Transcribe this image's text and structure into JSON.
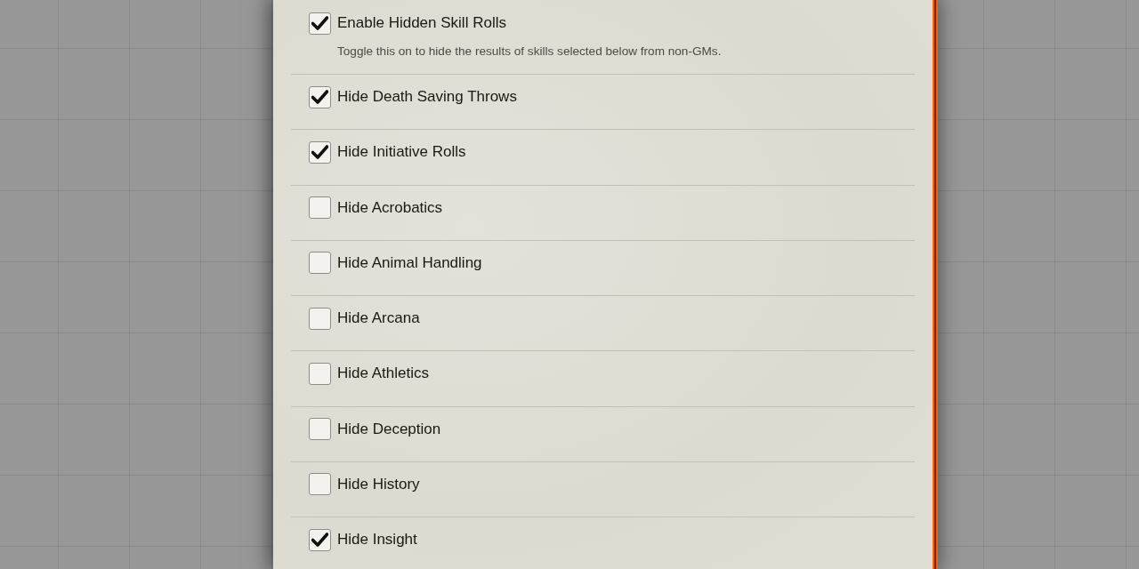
{
  "settings": [
    {
      "label": "Enable Hidden Skill Rolls",
      "hint": "Toggle this on to hide the results of skills selected below from non-GMs.",
      "checked": true
    },
    {
      "label": "Hide Death Saving Throws",
      "checked": true
    },
    {
      "label": "Hide Initiative Rolls",
      "checked": true
    },
    {
      "label": "Hide Acrobatics",
      "checked": false
    },
    {
      "label": "Hide Animal Handling",
      "checked": false
    },
    {
      "label": "Hide Arcana",
      "checked": false
    },
    {
      "label": "Hide Athletics",
      "checked": false
    },
    {
      "label": "Hide Deception",
      "checked": false
    },
    {
      "label": "Hide History",
      "checked": false
    },
    {
      "label": "Hide Insight",
      "checked": true
    }
  ]
}
